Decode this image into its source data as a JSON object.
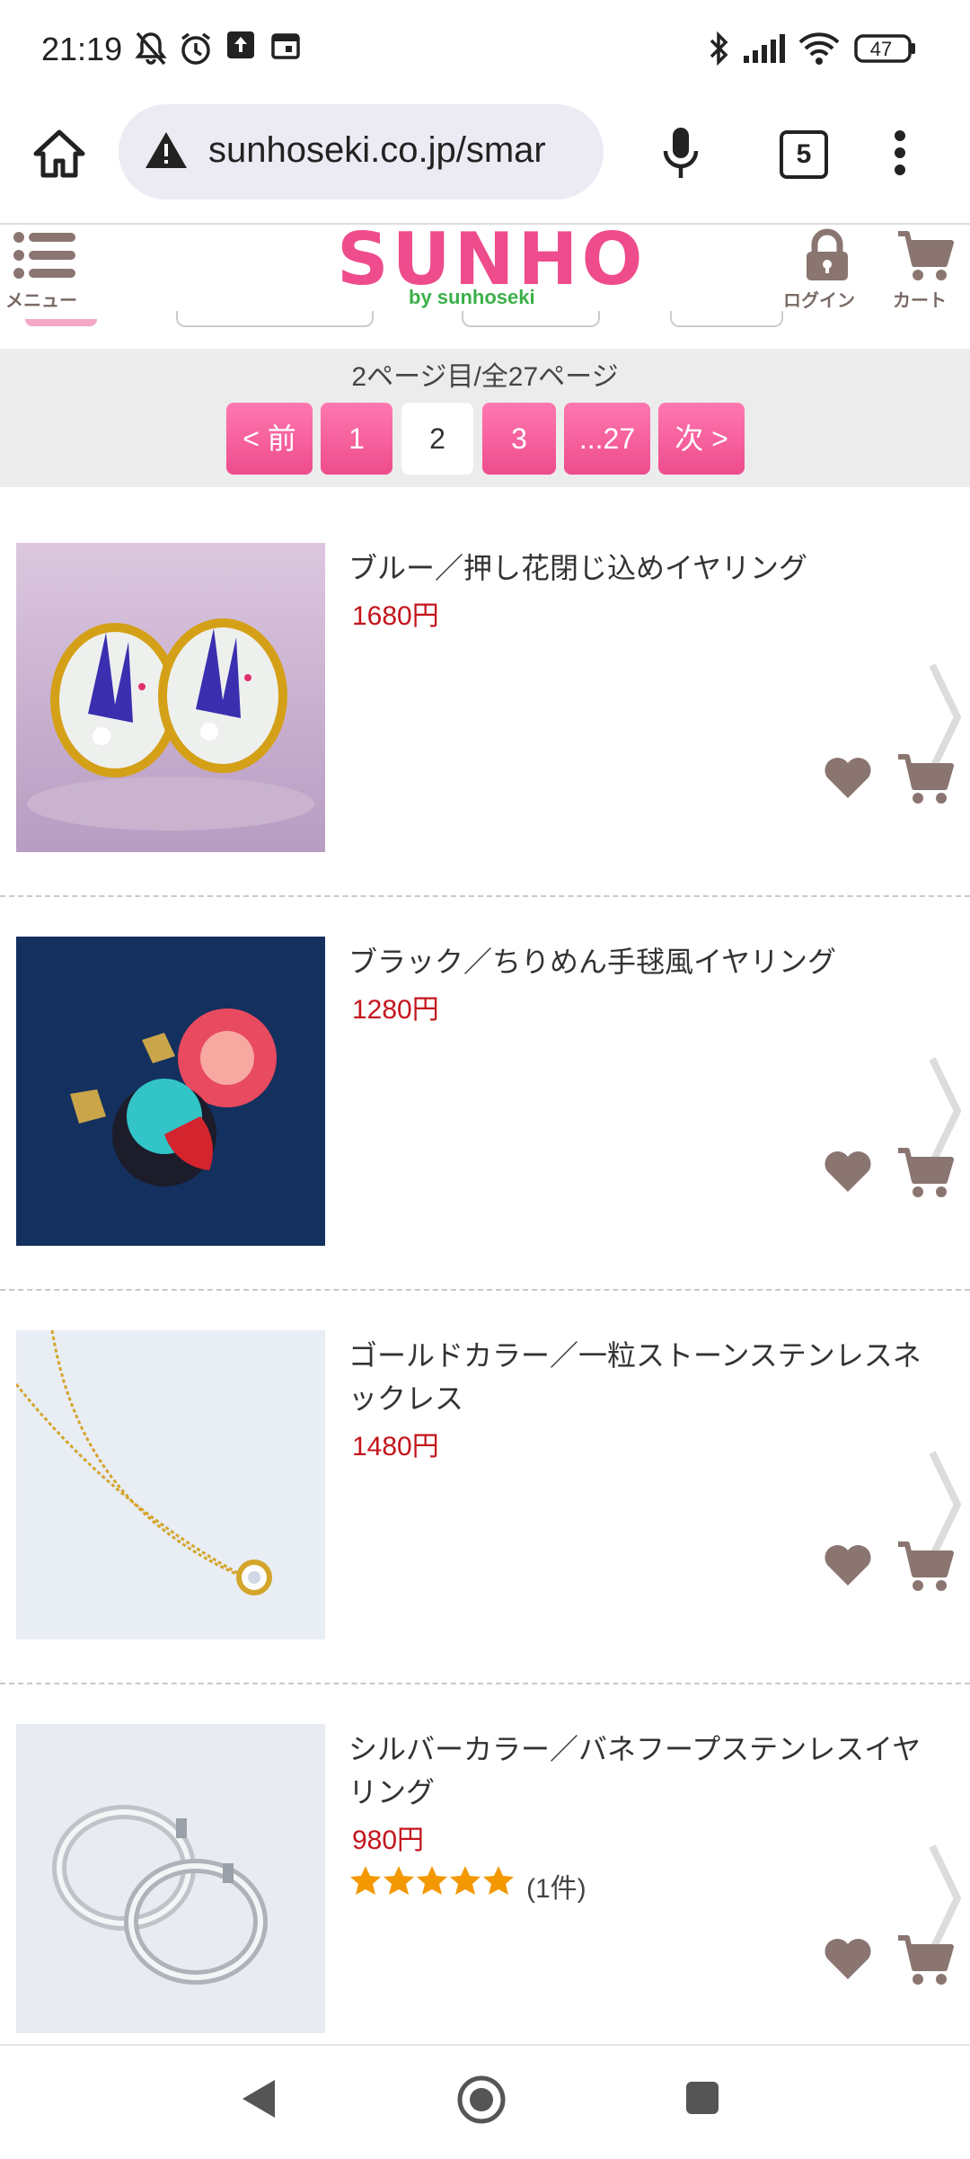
{
  "status_bar": {
    "time": "21:19",
    "battery": "47",
    "icons": [
      "bell-off-icon",
      "alarm-icon",
      "upload-icon",
      "calendar-icon",
      "bluetooth-icon",
      "signal-icon",
      "wifi-icon",
      "battery-icon"
    ]
  },
  "browser": {
    "url": "sunhoseki.co.jp/smar",
    "tab_count": "5",
    "icons": [
      "home-icon",
      "warning-icon",
      "mic-icon",
      "tabs-icon",
      "more-vert-icon"
    ]
  },
  "site_header": {
    "menu_label": "メニュー",
    "logo": "SUNHO",
    "logo_sub": "by sunhoseki",
    "login_label": "ログイン",
    "cart_label": "カート"
  },
  "pager": {
    "info": "2ページ目/全27ページ",
    "prev": "< 前",
    "pages": [
      "1",
      "2",
      "3",
      "...27"
    ],
    "current": "2",
    "next": "次 >"
  },
  "products": [
    {
      "name": "ブルー／押し花閉じ込めイヤリング",
      "price": "1680円"
    },
    {
      "name": "ブラック／ちりめん手毬風イヤリング",
      "price": "1280円"
    },
    {
      "name": "ゴールドカラー／一粒ストーンステンレスネックレス",
      "price": "1480円"
    },
    {
      "name": "シルバーカラー／バネフープステンレスイヤリング",
      "price": "980円",
      "rating": 5,
      "review_count": "(1件)"
    }
  ],
  "colors": {
    "brand_pink": "#ee4c8c",
    "brand_green": "#3bb049",
    "price_red": "#c4141c",
    "icon_brown": "#8a7570",
    "star_orange": "#f39800"
  }
}
